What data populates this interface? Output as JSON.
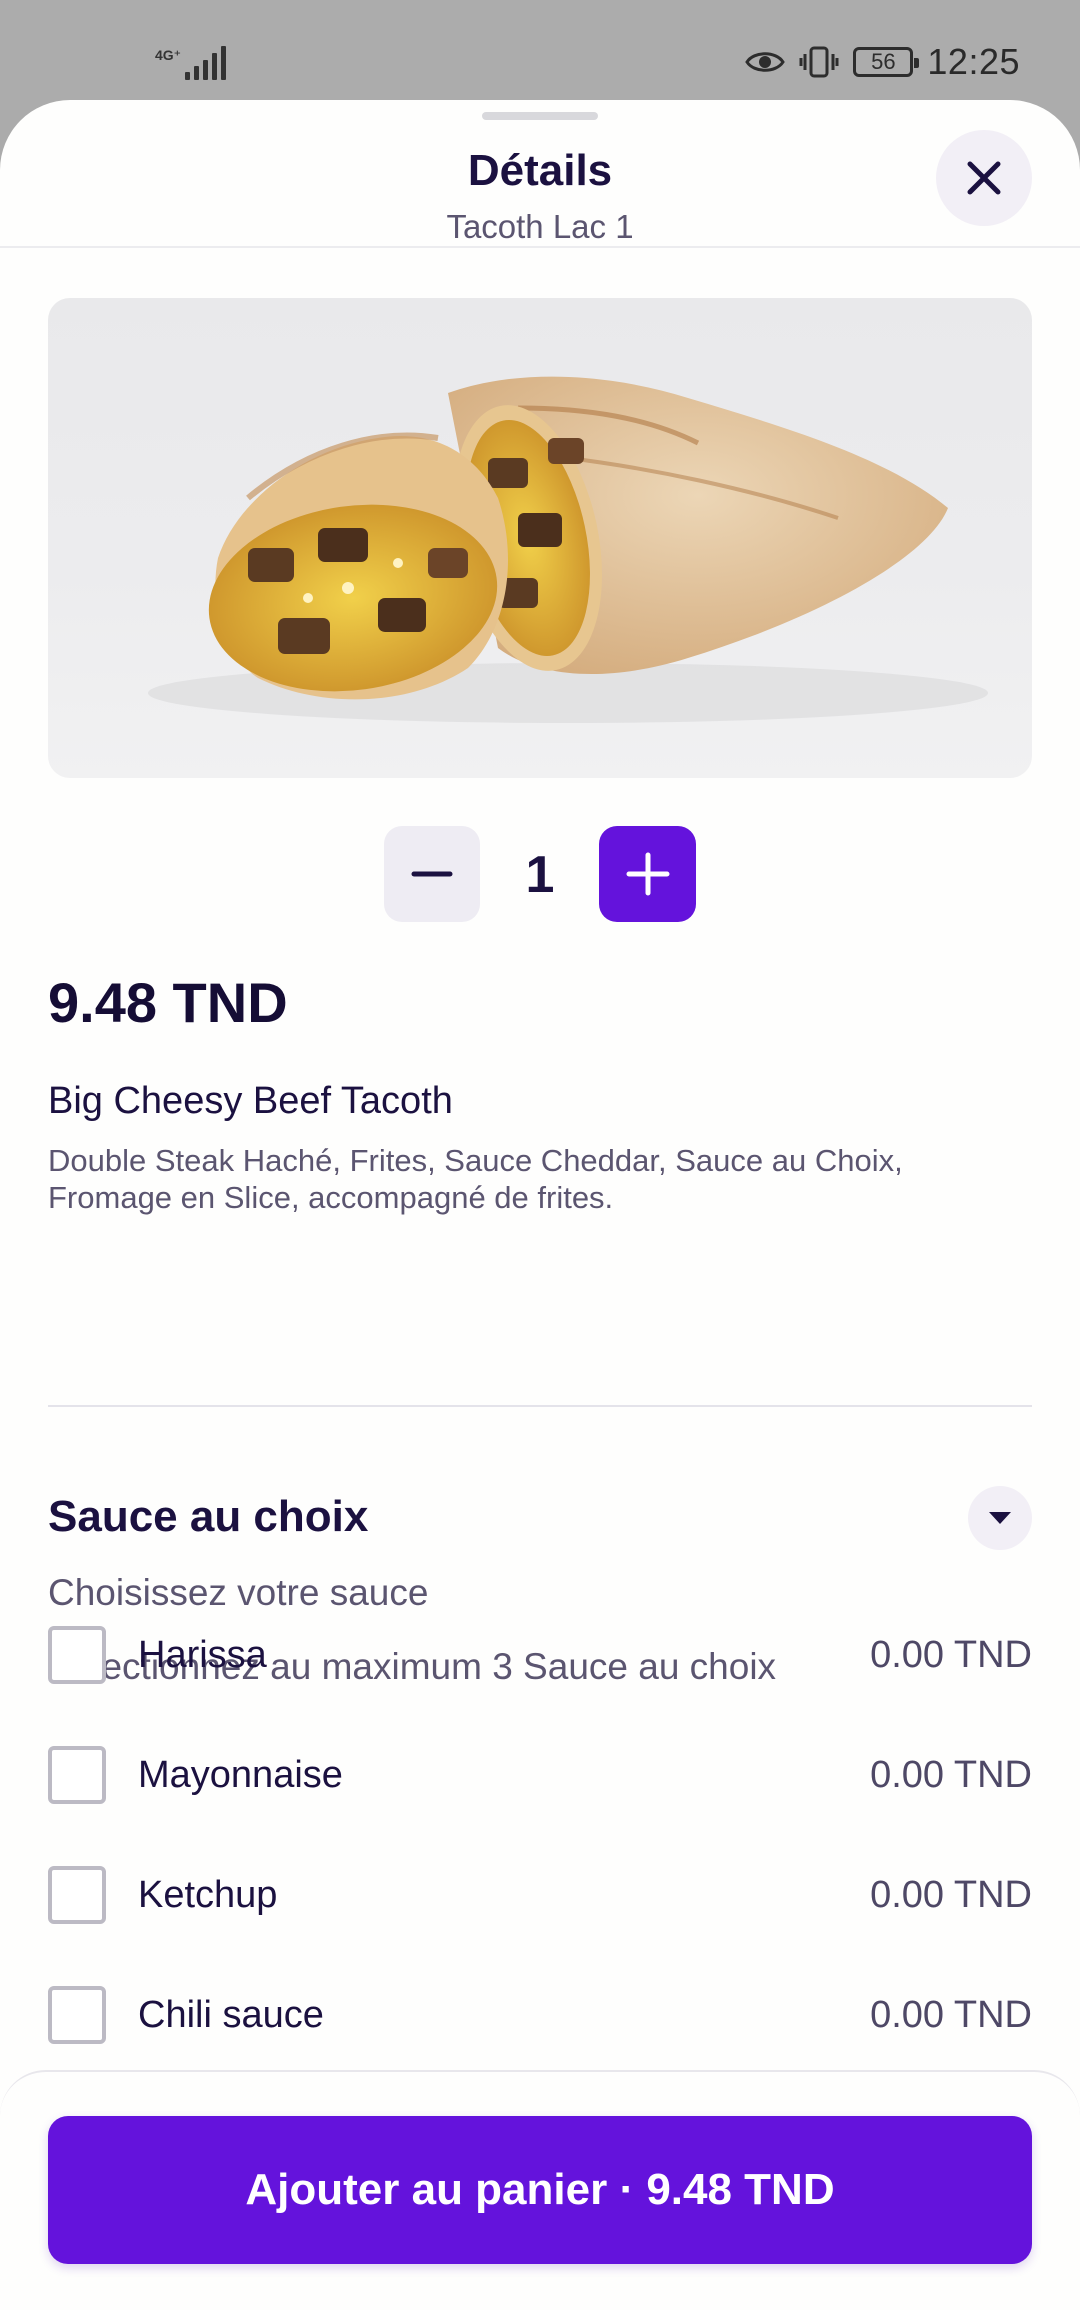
{
  "status_bar": {
    "network": "4G⁺",
    "battery": "56",
    "time": "12:25"
  },
  "header": {
    "title": "Détails",
    "subtitle": "Tacoth Lac 1"
  },
  "product": {
    "image_alt": "Big Cheesy Beef Tacoth",
    "quantity": "1",
    "price": "9.48 TND",
    "name": "Big Cheesy Beef Tacoth",
    "description": "Double Steak Haché, Frites, Sauce Cheddar, Sauce au Choix, Fromage en Slice, accompagné de frites."
  },
  "options": {
    "title": "Sauce au choix",
    "subtitle": "Choisissez votre sauce",
    "max_text": "Sélectionnez au maximum 3 Sauce au choix",
    "items": [
      {
        "label": "Harissa",
        "price": "0.00 TND"
      },
      {
        "label": "Mayonnaise",
        "price": "0.00 TND"
      },
      {
        "label": "Ketchup",
        "price": "0.00 TND"
      },
      {
        "label": "Chili sauce",
        "price": "0.00 TND"
      }
    ]
  },
  "footer": {
    "cta_label": "Ajouter au panier · 9.48 TND"
  },
  "colors": {
    "accent": "#6413dc",
    "text_dark": "#1b1140",
    "text_muted": "#5b5570"
  }
}
